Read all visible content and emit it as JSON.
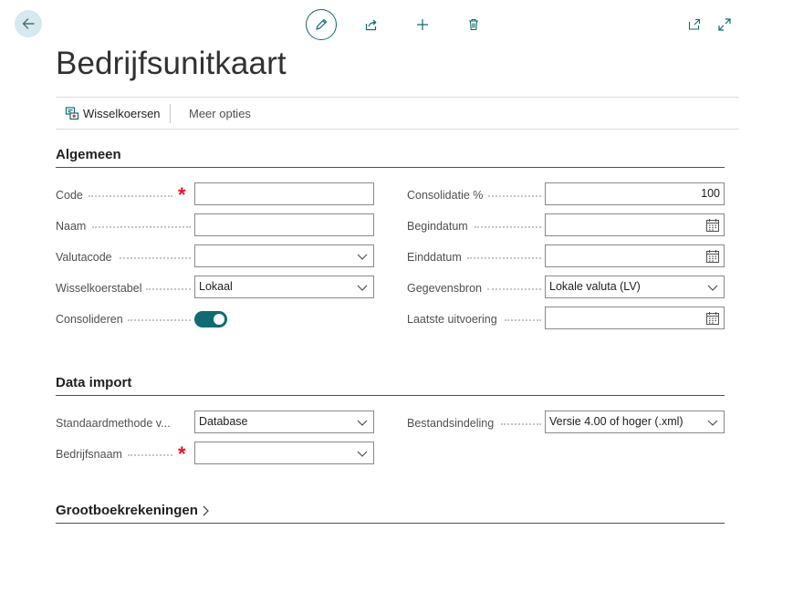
{
  "page": {
    "title": "Bedrijfsunitkaart"
  },
  "actions": {
    "exchange_rates": "Wisselkoersen",
    "more_options": "Meer opties"
  },
  "sections": {
    "general": {
      "heading": "Algemeen",
      "code": {
        "label": "Code",
        "value": ""
      },
      "name": {
        "label": "Naam",
        "value": ""
      },
      "currency_code": {
        "label": "Valutacode",
        "value": ""
      },
      "exchange_rate_table": {
        "label": "Wisselkoerstabel",
        "value": "Lokaal"
      },
      "consolidate": {
        "label": "Consolideren",
        "on": true
      },
      "consolidation_pct": {
        "label": "Consolidatie %",
        "value": "100"
      },
      "start_date": {
        "label": "Begindatum",
        "value": ""
      },
      "end_date": {
        "label": "Einddatum",
        "value": ""
      },
      "data_source": {
        "label": "Gegevensbron",
        "value": "Lokale valuta (LV)"
      },
      "last_run": {
        "label": "Laatste uitvoering",
        "value": ""
      }
    },
    "data_import": {
      "heading": "Data import",
      "default_method": {
        "label": "Standaardmethode v...",
        "value": "Database"
      },
      "company_name": {
        "label": "Bedrijfsnaam",
        "value": ""
      },
      "file_format": {
        "label": "Bestandsindeling",
        "value": "Versie 4.00 of hoger (.xml)"
      }
    },
    "gl_accounts": {
      "heading": "Grootboekrekeningen"
    }
  },
  "icons": {
    "back": "arrow-left-icon",
    "edit": "pencil-icon",
    "share": "share-icon",
    "new": "plus-icon",
    "delete": "trash-icon",
    "open_new": "open-in-new-window-icon",
    "expand": "expand-icon",
    "exchange": "exchange-rates-icon",
    "calendar": "calendar-icon",
    "dropdown": "chevron-down-icon",
    "section_expand": "chevron-right-icon"
  },
  "colors": {
    "accent": "#0f6b71",
    "required": "#e81123",
    "back_bg": "#d6e9ee"
  }
}
